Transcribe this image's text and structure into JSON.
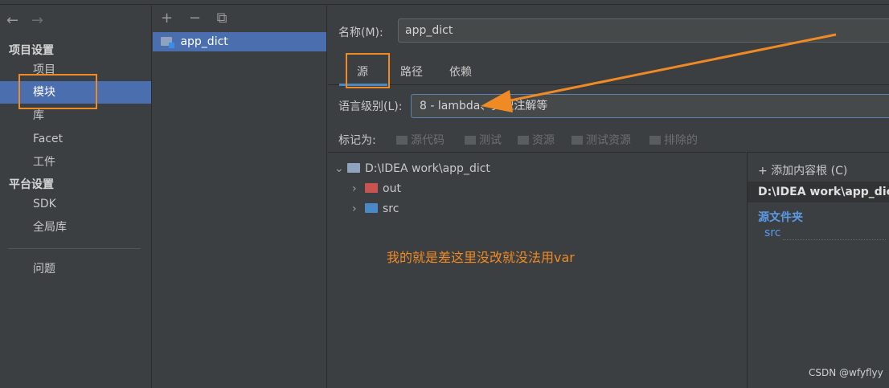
{
  "nav": {
    "back": "←",
    "forward": "→"
  },
  "sidebar": {
    "project_settings": "项目设置",
    "items_project": [
      {
        "label": "项目",
        "selected": false
      },
      {
        "label": "模块",
        "selected": true
      },
      {
        "label": "库",
        "selected": false
      },
      {
        "label": "Facet",
        "selected": false
      },
      {
        "label": "工件",
        "selected": false
      }
    ],
    "platform_settings": "平台设置",
    "items_platform": [
      {
        "label": "SDK"
      },
      {
        "label": "全局库"
      }
    ],
    "problems": "问题"
  },
  "modules": {
    "toolbar": {
      "add": "+",
      "remove": "−",
      "copy": "⧉"
    },
    "items": [
      "app_dict"
    ]
  },
  "detail": {
    "name_label": "名称(M):",
    "name_value": "app_dict",
    "tabs": [
      "源",
      "路径",
      "依赖"
    ],
    "active_tab": "源",
    "lang_label": "语言级别(L):",
    "lang_value": "8 - lambda、类型注解等",
    "mark_as_label": "标记为:",
    "mark_as_options": [
      "源代码",
      "测试",
      "资源",
      "测试资源",
      "排除的"
    ],
    "tree": {
      "root": "D:\\IDEA work\\app_dict",
      "children": [
        {
          "name": "out",
          "color": "#c75450"
        },
        {
          "name": "src",
          "color": "#4a88c7"
        }
      ]
    },
    "side": {
      "add_root": "添加内容根 (C)",
      "root_path": "D:\\IDEA work\\app_dict",
      "source_folders_title": "源文件夹",
      "source_folder": "src"
    }
  },
  "annotation": {
    "note": "我的就是差这里没改就没法用var",
    "color": "#f08a24"
  },
  "watermark": "CSDN @wfyflyy"
}
